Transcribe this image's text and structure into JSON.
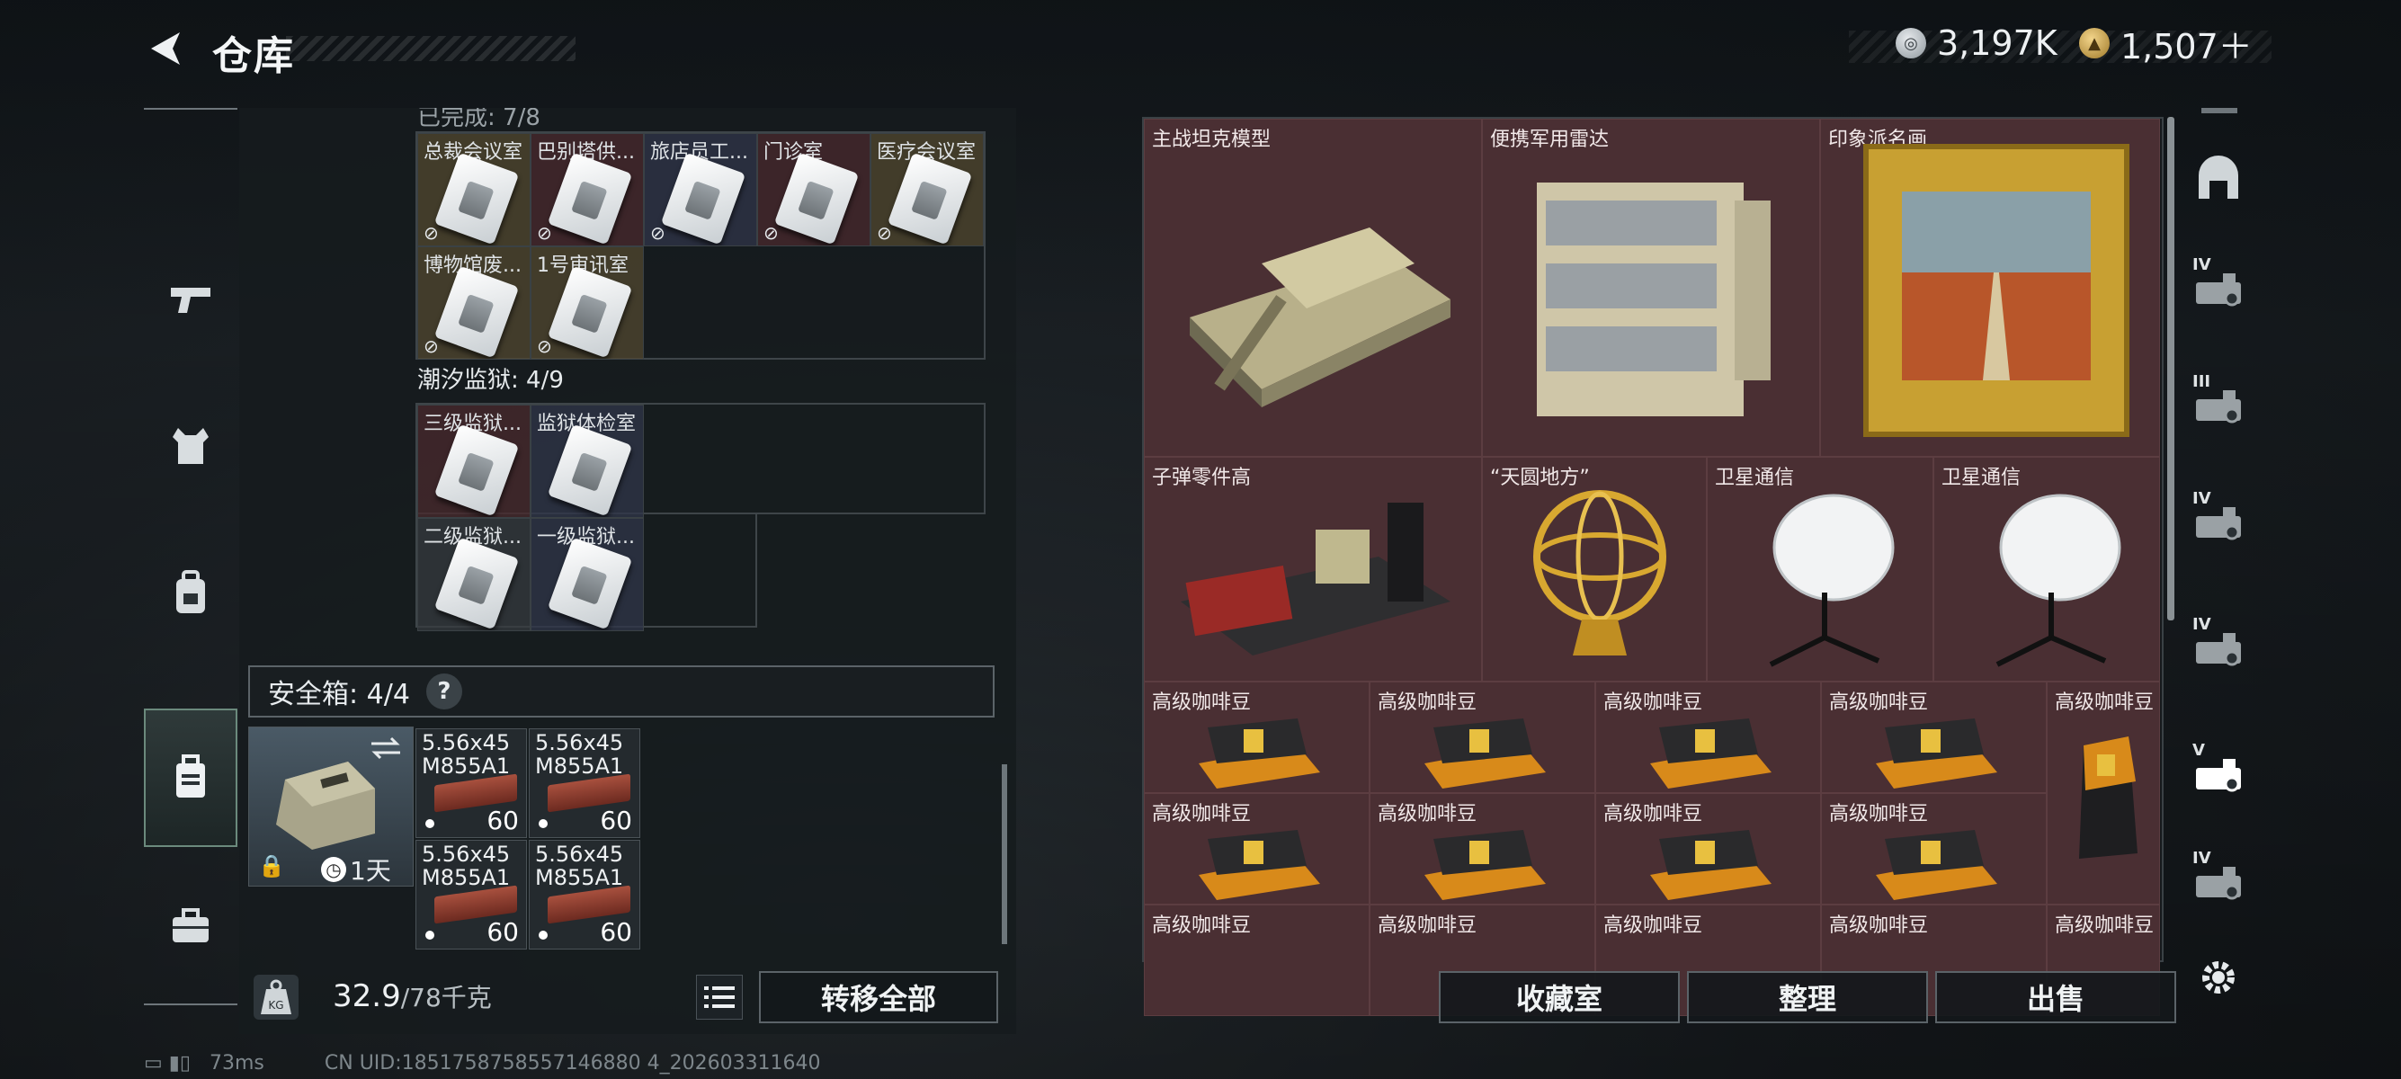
{
  "header": {
    "title": "仓库"
  },
  "currency": {
    "silver": "3,197K",
    "gold": "1,507＋"
  },
  "tabs": [
    "weapon-tab",
    "armor-tab",
    "backpack-tab",
    "rig-tab",
    "safebox-tab",
    "case-tab"
  ],
  "inventory": {
    "section1_cells": [
      {
        "label": "总裁会议室",
        "tone": "yellow"
      },
      {
        "label": "巴别塔供...",
        "tone": "maroon"
      },
      {
        "label": "旅店员工...",
        "tone": "navy"
      },
      {
        "label": "门诊室",
        "tone": "maroon"
      },
      {
        "label": "医疗会议室",
        "tone": "yellow"
      },
      {
        "label": "博物馆废...",
        "tone": "yellow"
      },
      {
        "label": "1号审讯室",
        "tone": "yellow"
      }
    ],
    "section2_title": "潮汐监狱: 4/9",
    "section2_cells": [
      {
        "label": "三级监狱...",
        "tone": "maroon"
      },
      {
        "label": "监狱体检室",
        "tone": "navy"
      },
      {
        "label": "二级监狱...",
        "tone": "gray"
      },
      {
        "label": "一级监狱...",
        "tone": "navy"
      }
    ]
  },
  "safebox": {
    "header": "安全箱: 4/4",
    "help": "?",
    "timer": "1天",
    "ammo": [
      {
        "name": "5.56x45 M855A1",
        "qty": "60"
      },
      {
        "name": "5.56x45 M855A1",
        "qty": "60"
      },
      {
        "name": "5.56x45 M855A1",
        "qty": "60"
      },
      {
        "name": "5.56x45 M855A1",
        "qty": "60"
      }
    ]
  },
  "weight": {
    "current": "32.9",
    "max": "/78千克"
  },
  "buttons": {
    "transfer_all": "转移全部",
    "collection": "收藏室",
    "organize": "整理",
    "sell": "出售"
  },
  "storage": {
    "big_items": [
      "主战坦克模型",
      "便携军用雷达",
      "印象派名画"
    ],
    "mid_items": [
      "子弹零件高",
      "“天圆地方”",
      "卫星通信",
      "卫星通信"
    ],
    "coffee_label": "高级咖啡豆"
  },
  "side_levels": [
    "IV",
    "III",
    "IV",
    "IV",
    "V",
    "IV"
  ],
  "status": {
    "ping": "73ms",
    "uid": "CN UID:1851758758557146880 4_202603311640"
  }
}
